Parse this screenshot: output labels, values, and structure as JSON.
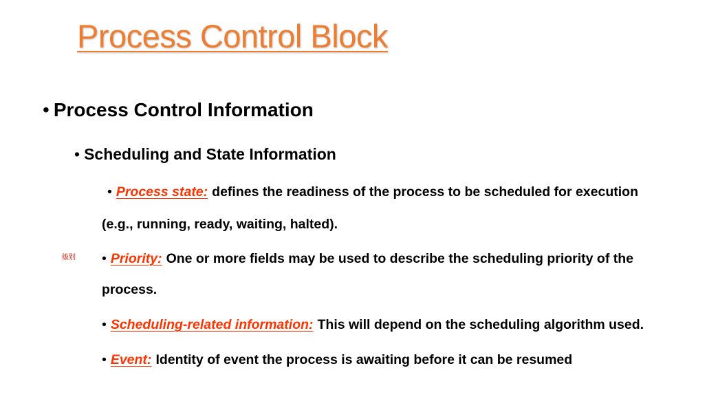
{
  "title": "Process Control Block",
  "level1": {
    "bullet": "•",
    "text": "Process Control Information"
  },
  "level2": {
    "bullet": "•",
    "text": "Scheduling and State Information"
  },
  "items": [
    {
      "bullet": "•",
      "term": "Process state:",
      "text_line1": "defines the readiness of the process to be scheduled for execution",
      "text_line2": "(e.g., running, ready, waiting, halted)."
    },
    {
      "bullet": "•",
      "term": "Priority:",
      "text_line1": "One or more fields may be used to describe the scheduling priority of the",
      "text_line2": "process."
    },
    {
      "bullet": "•",
      "term": "Scheduling-related information:",
      "text_line1": "This will depend on the scheduling algorithm used."
    },
    {
      "bullet": "•",
      "term": "Event:",
      "text_line1": "Identity of event the process is awaiting before it can be resumed"
    }
  ],
  "margin_note": "级别",
  "colors": {
    "title": "#ed7d31",
    "term": "#ff3300",
    "note": "#e0301e",
    "text": "#000000"
  }
}
